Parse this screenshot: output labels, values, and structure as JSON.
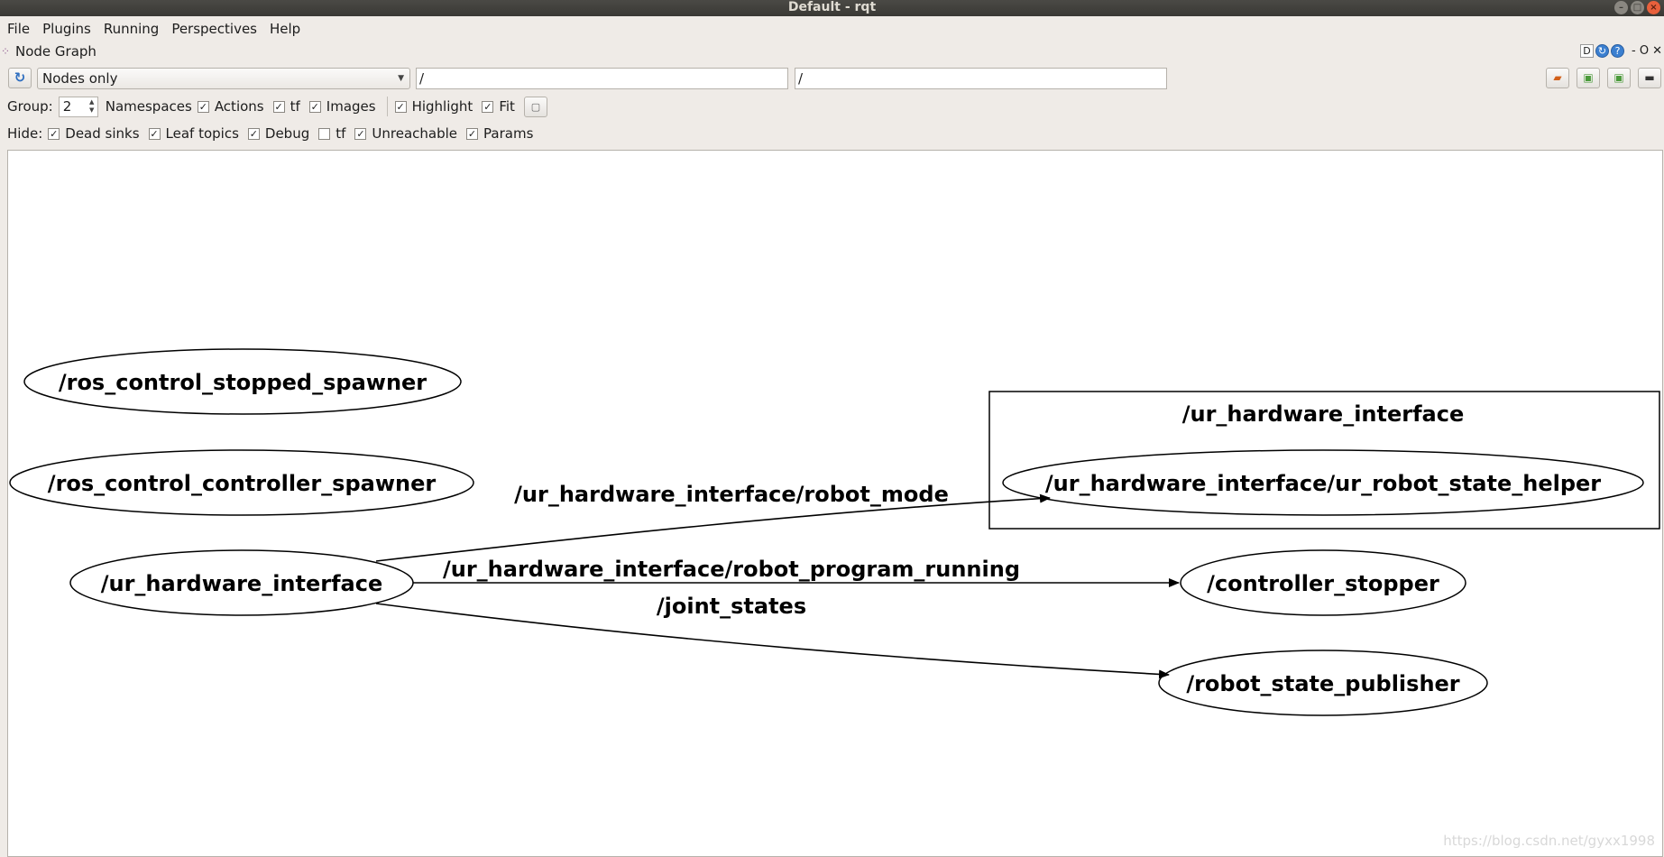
{
  "window": {
    "title": "Default - rqt"
  },
  "menu": [
    {
      "label": "File"
    },
    {
      "label": "Plugins"
    },
    {
      "label": "Running"
    },
    {
      "label": "Perspectives"
    },
    {
      "label": "Help"
    }
  ],
  "plugin": {
    "title": "Node Graph",
    "controls": [
      "D",
      "",
      "?",
      "- O",
      ""
    ]
  },
  "toolbar": {
    "mode": "Nodes only",
    "filter_ns": "/",
    "filter_topics": "/"
  },
  "options": {
    "group_label": "Group:",
    "group_value": "2",
    "namespaces": "Namespaces",
    "checks": [
      {
        "label": "Actions",
        "checked": true
      },
      {
        "label": "tf",
        "checked": true
      },
      {
        "label": "Images",
        "checked": true
      },
      {
        "label": "Highlight",
        "checked": true
      },
      {
        "label": "Fit",
        "checked": true
      }
    ]
  },
  "hide": {
    "label": "Hide:",
    "checks": [
      {
        "label": "Dead sinks",
        "checked": true
      },
      {
        "label": "Leaf topics",
        "checked": true
      },
      {
        "label": "Debug",
        "checked": true
      },
      {
        "label": "tf",
        "checked": false
      },
      {
        "label": "Unreachable",
        "checked": true
      },
      {
        "label": "Params",
        "checked": true
      }
    ]
  },
  "graph": {
    "nodes": {
      "stopped_spawner": "/ros_control_stopped_spawner",
      "controller_spawner": "/ros_control_controller_spawner",
      "ur_hw": "/ur_hardware_interface",
      "cluster_title": "/ur_hardware_interface",
      "state_helper": "/ur_hardware_interface/ur_robot_state_helper",
      "controller_stopper": "/controller_stopper",
      "robot_state_publisher": "/robot_state_publisher"
    },
    "edges": {
      "robot_mode": "/ur_hardware_interface/robot_mode",
      "program_running": "/ur_hardware_interface/robot_program_running",
      "joint_states": "/joint_states"
    }
  },
  "watermark": "https://blog.csdn.net/gyxx1998"
}
